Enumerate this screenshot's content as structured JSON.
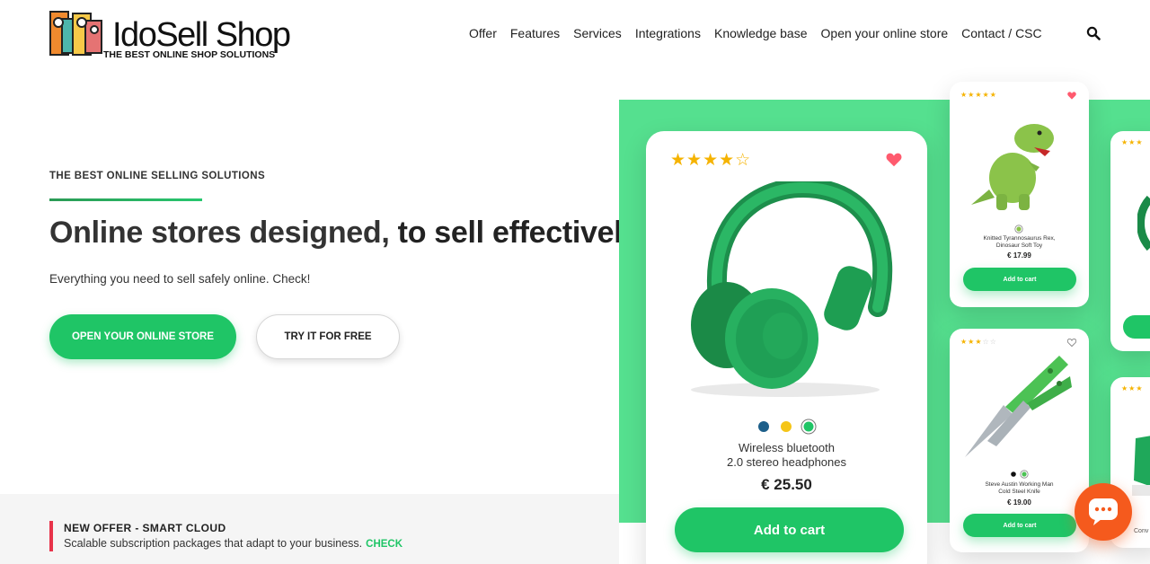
{
  "header": {
    "logo": {
      "brand": "IdoSell Shop",
      "tagline": "THE BEST ONLINE SHOP SOLUTIONS"
    },
    "nav": [
      "Offer",
      "Features",
      "Services",
      "Integrations",
      "Knowledge base",
      "Open your online store",
      "Contact / CSC"
    ],
    "search_icon": "search-icon"
  },
  "hero": {
    "eyebrow": "THE BEST ONLINE SELLING SOLUTIONS",
    "headline_regular": "Online stores designed, ",
    "headline_bold": "to sell effectively",
    "subline": "Everything you need to sell safely online. Check!",
    "primary_button": "OPEN YOUR ONLINE STORE",
    "secondary_button": "TRY IT FOR FREE"
  },
  "offer": {
    "title": "NEW OFFER - SMART CLOUD",
    "text": "Scalable subscription packages that adapt to your business.",
    "link": "CHECK"
  },
  "showcase": {
    "main_product": {
      "rating": 4,
      "rating_max": 5,
      "name_line1": "Wireless bluetooth",
      "name_line2": "2.0 stereo headphones",
      "price": "€ 25.50",
      "button": "Add to cart",
      "swatches": [
        "#1d5f8a",
        "#f5c518",
        "#1fc566"
      ]
    },
    "side_products": [
      {
        "rating": 5,
        "rating_max": 5,
        "name_line1": "Knitted Tyrannosaurus Rex,",
        "name_line2": "Dinosaur Soft Toy",
        "price": "€ 17.99",
        "button": "Add to cart"
      },
      {
        "rating": 3,
        "rating_max": 5,
        "name_line1": "Steve Austin Working Man",
        "name_line2": "Cold Steel Knife",
        "price": "€ 19.00",
        "button": "Add to cart"
      }
    ],
    "partial_card_text": "Conv"
  },
  "colors": {
    "accent_green": "#1fc566",
    "panel_green": "#55e08f",
    "offer_red": "#e8334a",
    "chat_orange": "#f55a1d"
  }
}
